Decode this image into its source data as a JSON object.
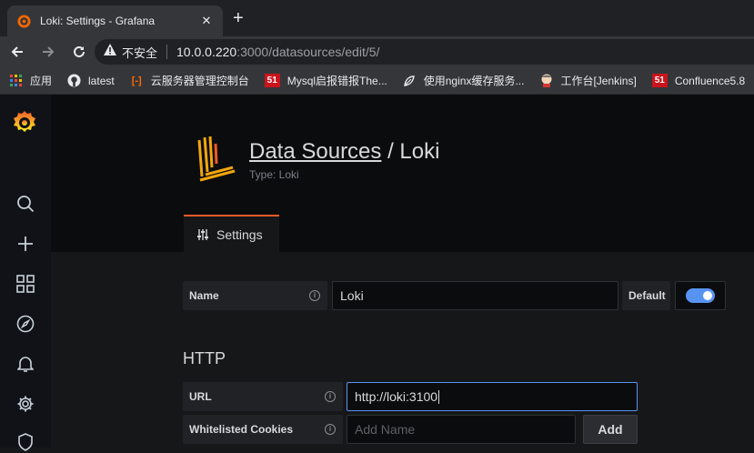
{
  "browser": {
    "tab_title": "Loki: Settings - Grafana",
    "new_tab_symbol": "+",
    "close_symbol": "✕",
    "security_label": "不安全",
    "url_host": "10.0.0.220",
    "url_rest": ":3000/datasources/edit/5/"
  },
  "bookmarks": [
    {
      "label": "应用",
      "icon": "apps-grid-icon"
    },
    {
      "label": "latest",
      "icon": "github-icon"
    },
    {
      "label": "云服务器管理控制台",
      "icon": "aliyun-icon"
    },
    {
      "label": "Mysql启报错报The...",
      "icon": "51cto-icon",
      "badge": "51"
    },
    {
      "label": "使用nginx缓存服务...",
      "icon": "leaf-icon"
    },
    {
      "label": "工作台[Jenkins]",
      "icon": "jenkins-icon"
    },
    {
      "label": "Confluence5.8",
      "icon": "51cto-icon",
      "badge": "51"
    }
  ],
  "header": {
    "breadcrumb_link": "Data Sources",
    "breadcrumb_sep": " / ",
    "name": "Loki",
    "subtitle": "Type: Loki",
    "tab_settings": "Settings"
  },
  "form": {
    "name_label": "Name",
    "name_value": "Loki",
    "default_label": "Default",
    "default_on": true,
    "http_title": "HTTP",
    "url_label": "URL",
    "url_value": "http://loki:3100",
    "cookies_label": "Whitelisted Cookies",
    "cookies_placeholder": "Add Name",
    "add_button": "Add"
  },
  "colors": {
    "accent_blue": "#5794f2",
    "grafana_orange": "#f05a28",
    "loki_yellow": "#f2a60c"
  }
}
